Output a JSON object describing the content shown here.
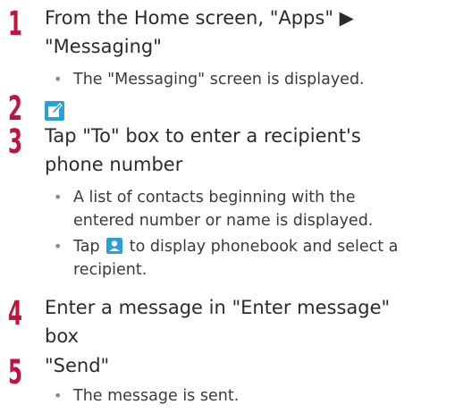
{
  "steps": [
    {
      "number": "1",
      "title_line1": "From the Home screen, \"Apps\" ▶",
      "title_line2": "\"Messaging\"",
      "notes": [
        "The \"Messaging\" screen is displayed."
      ]
    },
    {
      "number": "2",
      "icon": "compose-message-icon"
    },
    {
      "number": "3",
      "title_line1": "Tap \"To\" box to enter a recipient's",
      "title_line2": "phone number",
      "notes": [
        "A list of contacts beginning with the",
        "entered number or name is displayed."
      ],
      "note2_before": "Tap",
      "note2_after": "to display phonebook and select a",
      "note2_line2": "recipient.",
      "note2_icon": "contact-person-icon"
    },
    {
      "number": "4",
      "title_line1": "Enter a message in \"Enter message\"",
      "title_line2": "box"
    },
    {
      "number": "5",
      "title_line1": "\"Send\"",
      "notes": [
        "The message is sent."
      ]
    }
  ],
  "bullet": "•",
  "colors": {
    "step_number": "#c0143c",
    "icon_blue": "#2a9fd8"
  }
}
